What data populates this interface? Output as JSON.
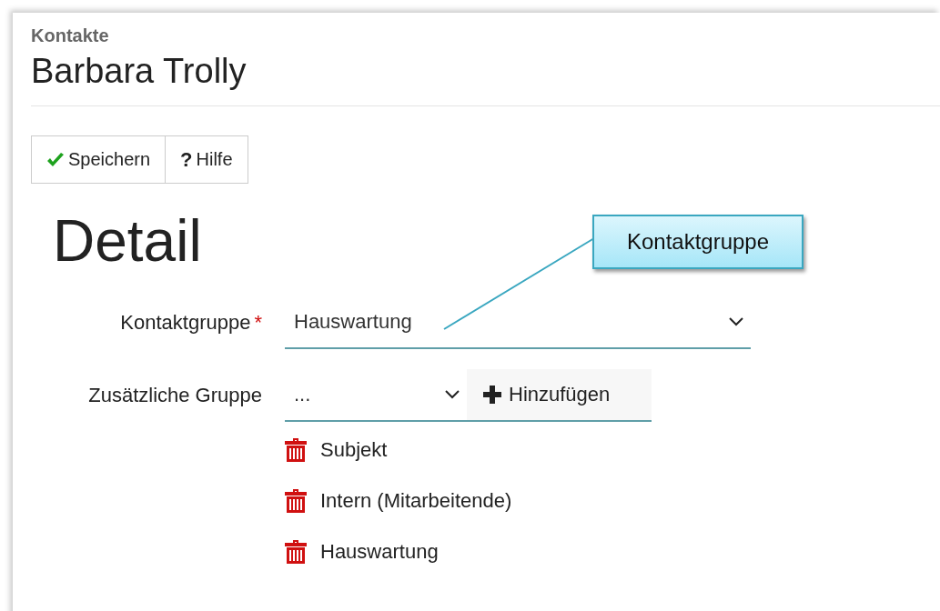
{
  "breadcrumb": "Kontakte",
  "title": "Barbara Trolly",
  "toolbar": [
    {
      "kind": "save",
      "label": "Speichern"
    },
    {
      "kind": "help",
      "icon": "?",
      "label": "Hilfe"
    }
  ],
  "heading": "Detail",
  "fields": [
    {
      "kind": "select",
      "label": "Kontaktgruppe",
      "required": true,
      "required_mark": "*",
      "value": "Hauswartung"
    },
    {
      "kind": "select-add",
      "label": "Zusätzliche Gruppe",
      "required": false,
      "value": "...",
      "button": "Hinzufügen"
    }
  ],
  "groups": [
    "Subjekt",
    "Intern (Mitarbeitende)",
    "Hauswartung"
  ],
  "callout": {
    "text": "Kontaktgruppe"
  }
}
